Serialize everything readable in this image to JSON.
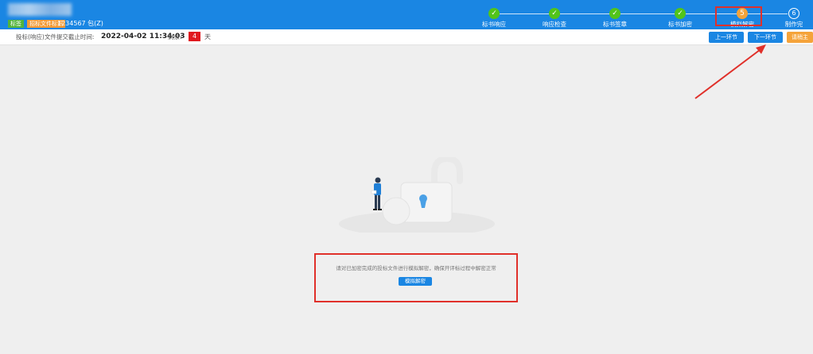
{
  "header": {
    "tag_green": "标签",
    "tag_orange": "招标文件标识",
    "project_id": "1234567 包(Z)",
    "steps": [
      {
        "label": "标书响应",
        "status": "done"
      },
      {
        "label": "响应检查",
        "status": "done"
      },
      {
        "label": "标书签章",
        "status": "done"
      },
      {
        "label": "标书加密",
        "status": "done"
      },
      {
        "label": "模拟解密",
        "status": "current",
        "number": "5"
      },
      {
        "label": "制作完",
        "status": "todo",
        "number": "6"
      }
    ]
  },
  "subbar": {
    "deadline_label": "投标(响应)文件提交截止时间:",
    "deadline_time": "2022-04-02 11:34:03",
    "remain_label": "剩余:",
    "remain_days": "4",
    "remain_unit": "天",
    "prev_button": "上一环节",
    "next_button": "下一环节",
    "orange_button": "请稍主"
  },
  "main": {
    "notice": "请对已加密完成的投标文件进行模拟解密，确保开评标过程中解密正常",
    "decrypt_button": "模拟解密"
  },
  "colors": {
    "primary": "#1a86e3",
    "success": "#52c41a",
    "warning": "#f5a33a",
    "danger": "#e0191e",
    "annotation": "#e0302a"
  }
}
